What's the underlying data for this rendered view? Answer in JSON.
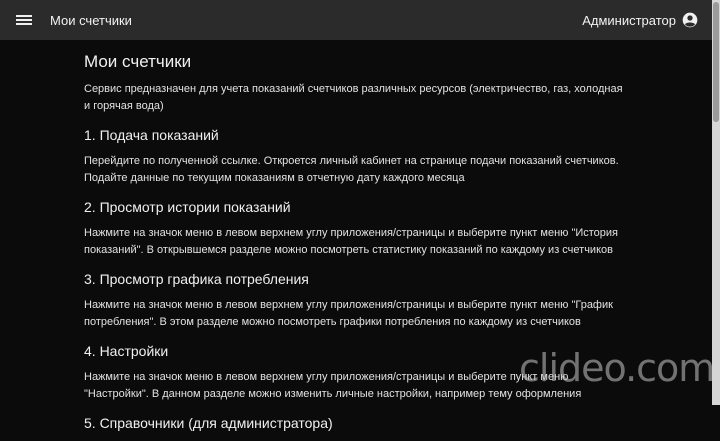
{
  "header": {
    "app_title": "Мои счетчики",
    "user_label": "Администратор"
  },
  "page": {
    "title": "Мои счетчики",
    "intro": "Сервис предназначен для учета показаний счетчиков различных ресурсов (электричество, газ, холодная и горячая вода)",
    "sections": [
      {
        "heading": "1. Подача показаний",
        "text": "Перейдите по полученной ссылке. Откроется личный кабинет на странице подачи показаний счетчиков. Подайте данные по текущим показаниям в отчетную дату каждого месяца"
      },
      {
        "heading": "2. Просмотр истории показаний",
        "text": "Нажмите на значок меню в левом верхнем углу приложения/страницы и выберите пункт меню \"История показаний\". В открывшемся разделе можно посмотреть статистику показаний по каждому из счетчиков"
      },
      {
        "heading": "3. Просмотр графика потребления",
        "text": "Нажмите на значок меню в левом верхнем углу приложения/страницы и выберите пункт меню \"График потребления\". В этом разделе можно посмотреть графики потребления по каждому из счетчиков"
      },
      {
        "heading": "4. Настройки",
        "text": "Нажмите на значок меню в левом верхнем углу приложения/страницы и выберите пункт меню \"Настройки\". В данном разделе можно изменить личные настройки, например тему оформления"
      },
      {
        "heading": "5. Справочники (для администратора)"
      }
    ]
  },
  "watermark": "clideo.com",
  "icons": {
    "menu": "hamburger-menu-icon",
    "user": "account-circle-icon"
  },
  "colors": {
    "appbar": "#2b2b2b",
    "background": "#0c0b0c",
    "text": "#e8e8e8"
  }
}
